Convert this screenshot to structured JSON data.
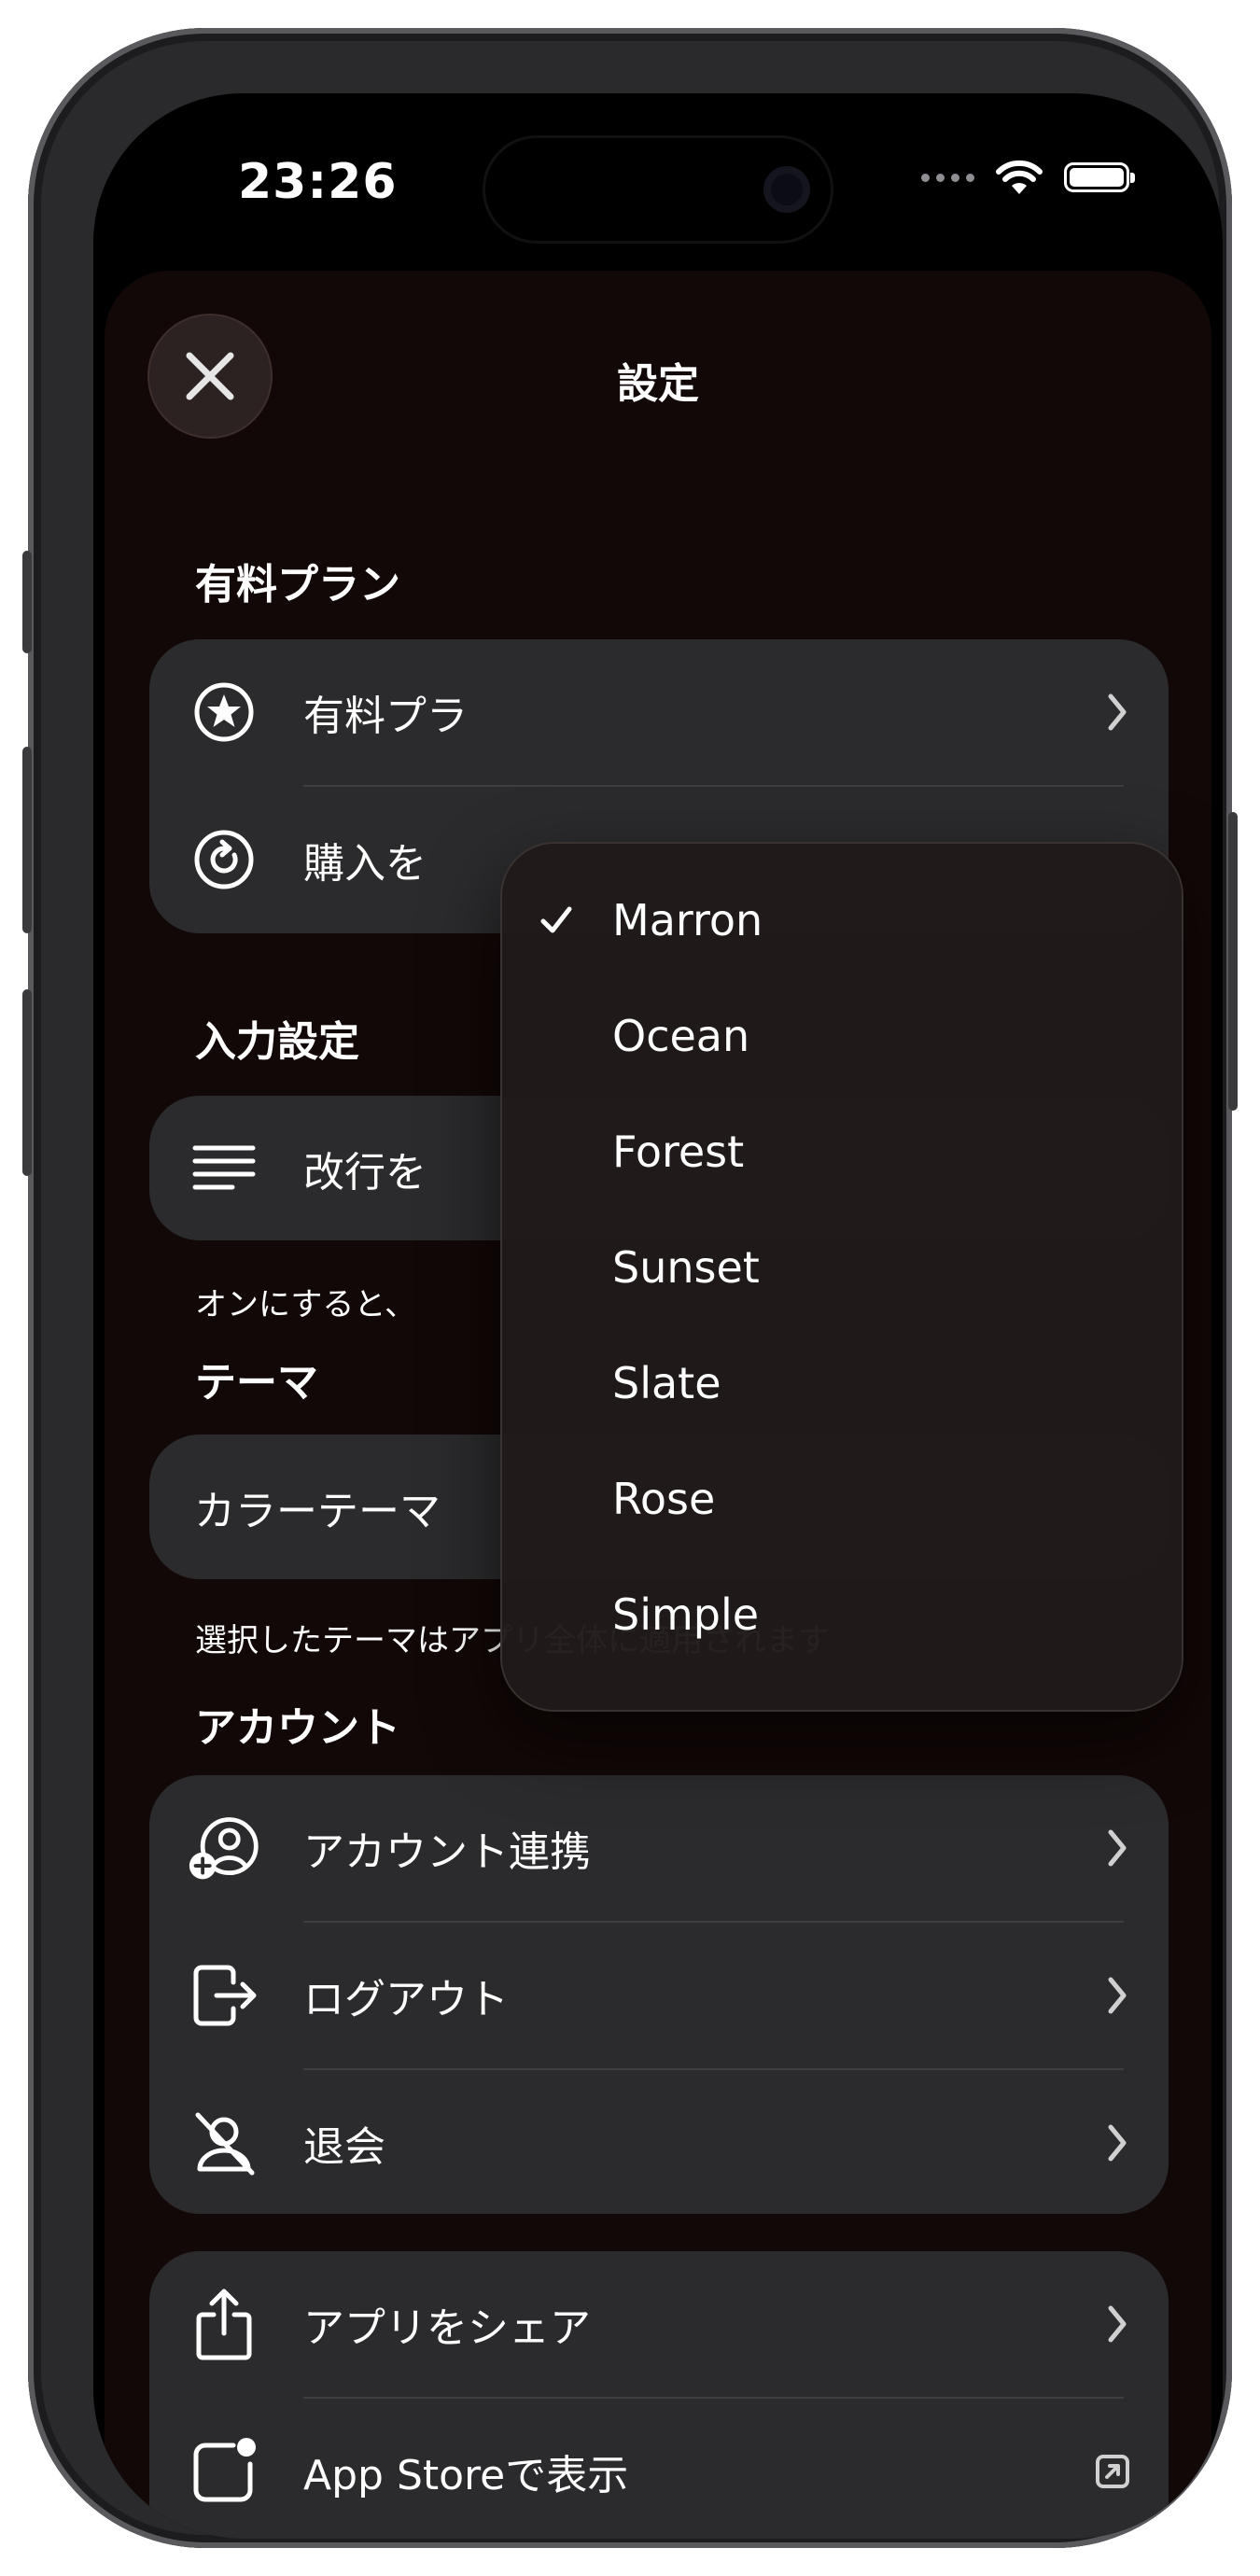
{
  "status_bar": {
    "time": "23:26"
  },
  "sheet": {
    "title": "設定"
  },
  "sections": {
    "premium": {
      "title": "有料プラン",
      "rows": [
        {
          "label": "有料プラ"
        },
        {
          "label": "購入を"
        }
      ]
    },
    "input": {
      "title": "入力設定",
      "rows": [
        {
          "label": "改行を"
        }
      ],
      "footnote": "オンにすると、"
    },
    "theme": {
      "title": "テーマ",
      "rows": [
        {
          "label": "カラーテーマ"
        }
      ],
      "footnote": "選択したテーマはアプリ全体に適用されます"
    },
    "account": {
      "title": "アカウント",
      "rows": [
        {
          "label": "アカウント連携"
        },
        {
          "label": "ログアウト"
        },
        {
          "label": "退会"
        }
      ]
    },
    "app": {
      "rows": [
        {
          "label": "アプリをシェア"
        },
        {
          "label": "App Storeで表示"
        }
      ]
    }
  },
  "theme_menu": {
    "selected": "Marron",
    "options": [
      "Marron",
      "Ocean",
      "Forest",
      "Sunset",
      "Slate",
      "Rose",
      "Simple"
    ]
  },
  "colors": {
    "sheet_bg": "#120807",
    "group_bg": "#2b2b2d",
    "text": "#ffffff"
  }
}
